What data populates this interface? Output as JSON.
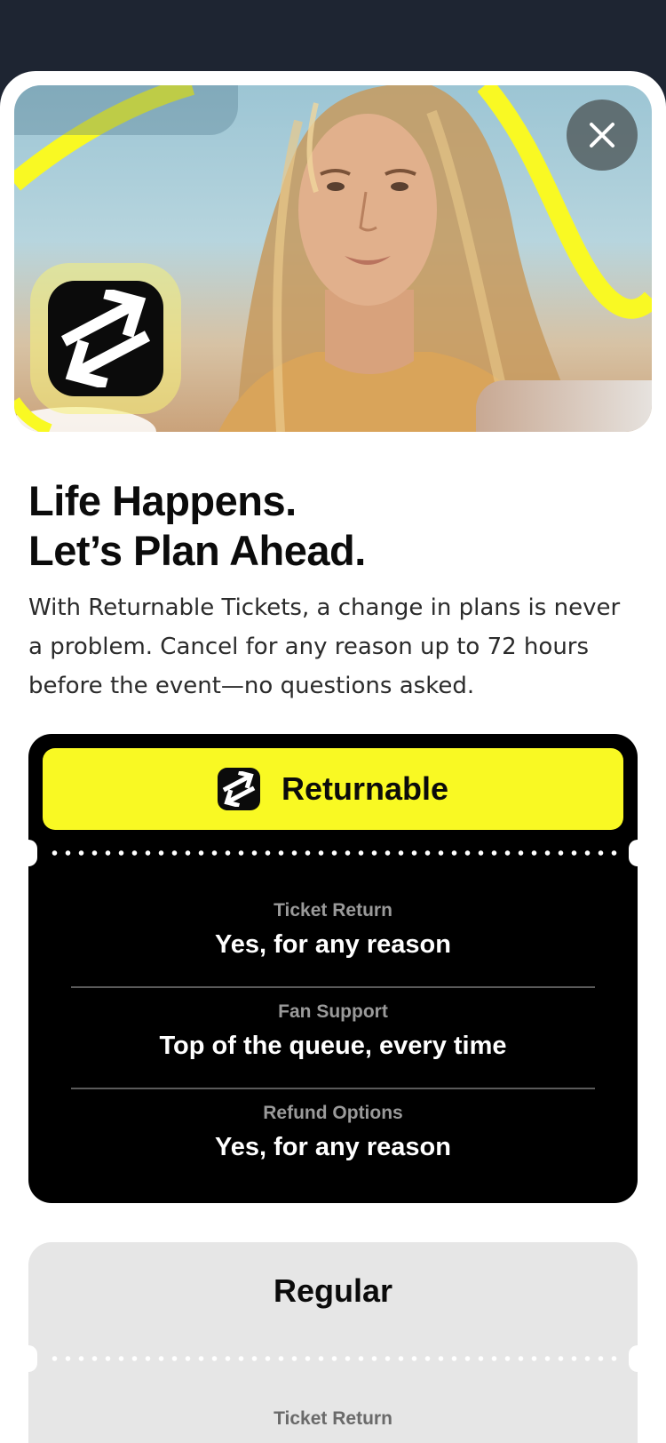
{
  "hero": {
    "close_icon": "close-icon",
    "logo_icon": "returnable-arrows-icon",
    "accent_color": "#f9f923"
  },
  "headline": {
    "line1": "Life Happens.",
    "line2": "Let’s Plan Ahead."
  },
  "description": "With Returnable Tickets, a change in plans is never a problem. Cancel for any reason up to 72 hours before the event—no questions asked.",
  "returnable_card": {
    "title": "Returnable",
    "icon": "returnable-arrows-icon",
    "features": [
      {
        "label": "Ticket Return",
        "value": "Yes, for any reason"
      },
      {
        "label": "Fan Support",
        "value": "Top of the queue, every time"
      },
      {
        "label": "Refund Options",
        "value": "Yes, for any reason"
      }
    ]
  },
  "regular_card": {
    "title": "Regular",
    "features": [
      {
        "label": "Ticket Return"
      }
    ]
  }
}
